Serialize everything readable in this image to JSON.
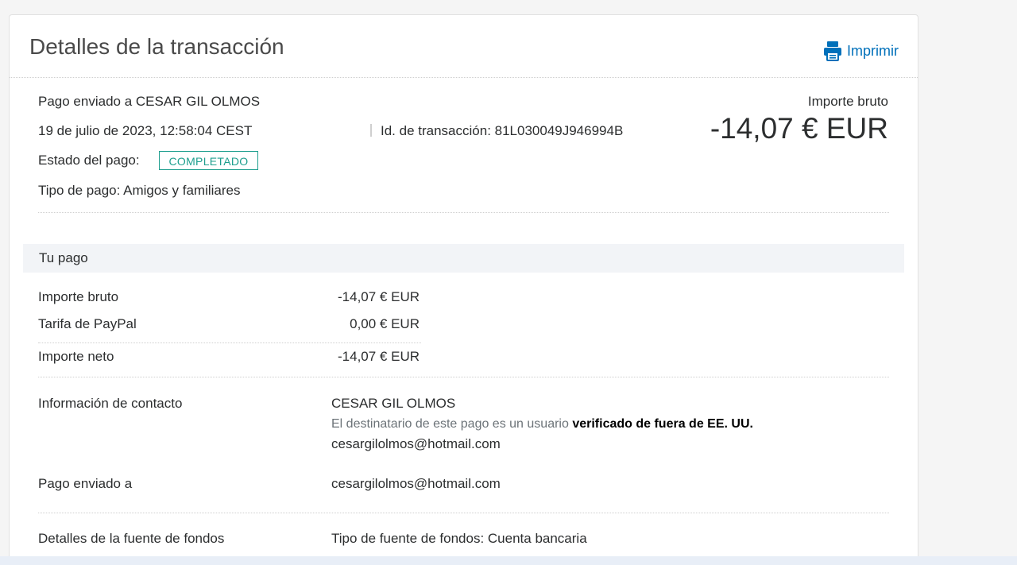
{
  "header": {
    "title": "Detalles de la transacción",
    "print_label": "Imprimir"
  },
  "summary": {
    "payment_sent_to": "Pago enviado a CESAR GIL OLMOS",
    "datetime": "19 de julio de 2023, 12:58:04 CEST",
    "transaction_id": "Id. de transacción: 81L030049J946994B",
    "status_label": "Estado del pago:",
    "status_value": "COMPLETADO",
    "payment_type": "Tipo de pago: Amigos y familiares",
    "gross_label": "Importe bruto",
    "gross_amount": "-14,07 € EUR"
  },
  "your_payment": {
    "section_title": "Tu pago",
    "rows": [
      {
        "label": "Importe bruto",
        "value": "-14,07 € EUR"
      },
      {
        "label": "Tarifa de PayPal",
        "value": "0,00 € EUR"
      },
      {
        "label": "Importe neto",
        "value": "-14,07 € EUR"
      }
    ]
  },
  "contact": {
    "label": "Información de contacto",
    "name": "CESAR GIL OLMOS",
    "verified_note_prefix": "El destinatario de este pago es un usuario",
    "verified_note_bold": "verificado de fuera de EE. UU.",
    "email": "cesargilolmos@hotmail.com"
  },
  "sent_to": {
    "label": "Pago enviado a",
    "email": "cesargilolmos@hotmail.com"
  },
  "funding": {
    "label": "Detalles de la fuente de fondos",
    "type": "Tipo de fuente de fondos: Cuenta bancaria"
  },
  "colors": {
    "brand_blue": "#0070ba",
    "status_green": "#1e9e8e",
    "section_bg": "#f2f4f7"
  },
  "icons": {
    "print": "printer-icon"
  }
}
